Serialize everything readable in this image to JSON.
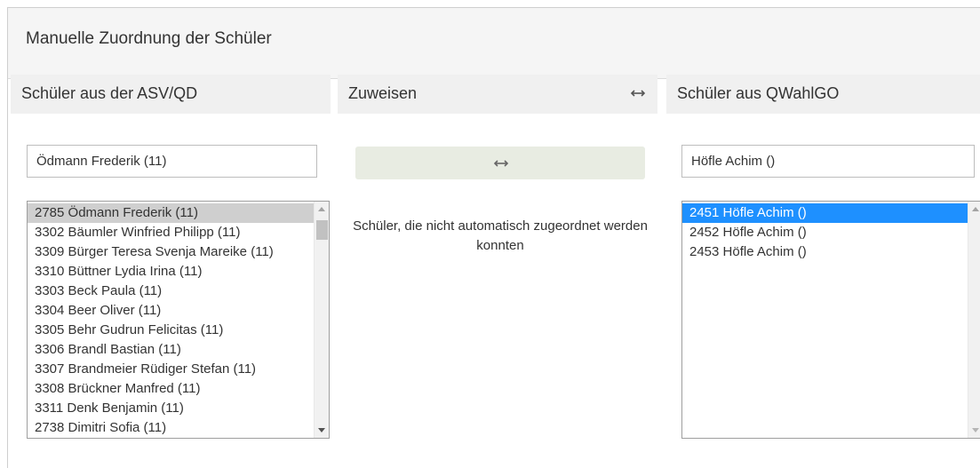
{
  "panel": {
    "title": "Manuelle Zuordnung der Schüler"
  },
  "columns": {
    "left_header": "Schüler aus der ASV/QD",
    "mid_header": "Zuweisen",
    "right_header": "Schüler aus QWahlGO"
  },
  "left_input": {
    "value": "Ödmann Frederik (11)"
  },
  "right_input": {
    "value": "Höfle Achim ()"
  },
  "assign_button": {
    "icon": "swap-arrows-icon"
  },
  "middle_message": "Schüler, die nicht automatisch zugeordnet werden konnten",
  "left_list": {
    "selected_index": 0,
    "items": [
      "2785 Ödmann Frederik (11)",
      "3302 Bäumler Winfried Philipp (11)",
      "3309 Bürger Teresa Svenja Mareike (11)",
      "3310 Büttner Lydia Irina (11)",
      "3303 Beck Paula (11)",
      "3304 Beer Oliver (11)",
      "3305 Behr Gudrun Felicitas (11)",
      "3306 Brandl Bastian (11)",
      "3307 Brandmeier Rüdiger Stefan (11)",
      "3308 Brückner Manfred (11)",
      "3311 Denk Benjamin (11)",
      "2738 Dimitri Sofia (11)"
    ]
  },
  "right_list": {
    "selected_index": 0,
    "items": [
      "2451 Höfle Achim ()",
      "2452 Höfle Achim ()",
      "2453 Höfle Achim ()"
    ]
  },
  "colors": {
    "selected_gray": "#cfcfcf",
    "selected_blue": "#1e90ff",
    "assign_button_bg": "#e8ece2",
    "header_bg": "#f0f0f0"
  }
}
